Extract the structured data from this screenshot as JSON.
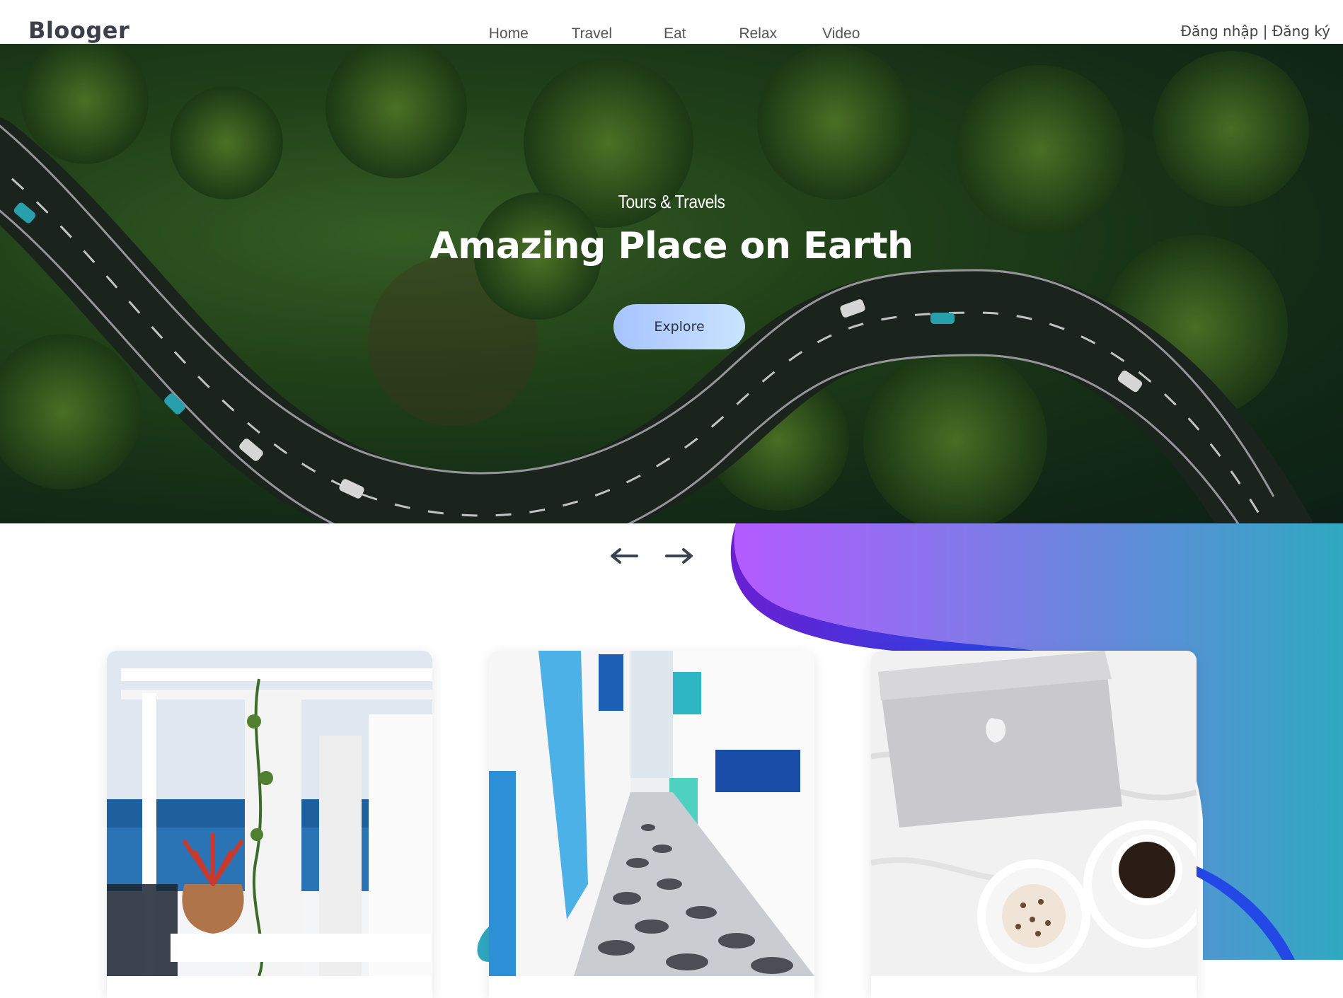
{
  "brand": {
    "logo": "Blooger"
  },
  "nav": {
    "items": [
      {
        "label": "Home"
      },
      {
        "label": "Travel"
      },
      {
        "label": "Eat"
      },
      {
        "label": "Relax"
      },
      {
        "label": "Video"
      }
    ]
  },
  "auth": {
    "login": "Đăng nhập",
    "separator": "|",
    "register": "Đăng ký"
  },
  "hero": {
    "subtitle": "Tours & Travels",
    "title": "Amazing Place on Earth",
    "button": "Explore"
  },
  "slider": {
    "prev_icon": "arrow-left-icon",
    "next_icon": "arrow-right-icon"
  },
  "cards": [
    {
      "image": "santorini-balcony-photo"
    },
    {
      "image": "greek-alley-photo"
    },
    {
      "image": "laptop-coffee-bed-photo"
    }
  ],
  "colors": {
    "logo": "#3a3f4a",
    "button_start": "#a7c3ff",
    "button_end": "#c9e4ff",
    "gradient_purple": "#b35bff",
    "gradient_teal": "#2fa9c1",
    "accent_blue": "#2448e6"
  }
}
